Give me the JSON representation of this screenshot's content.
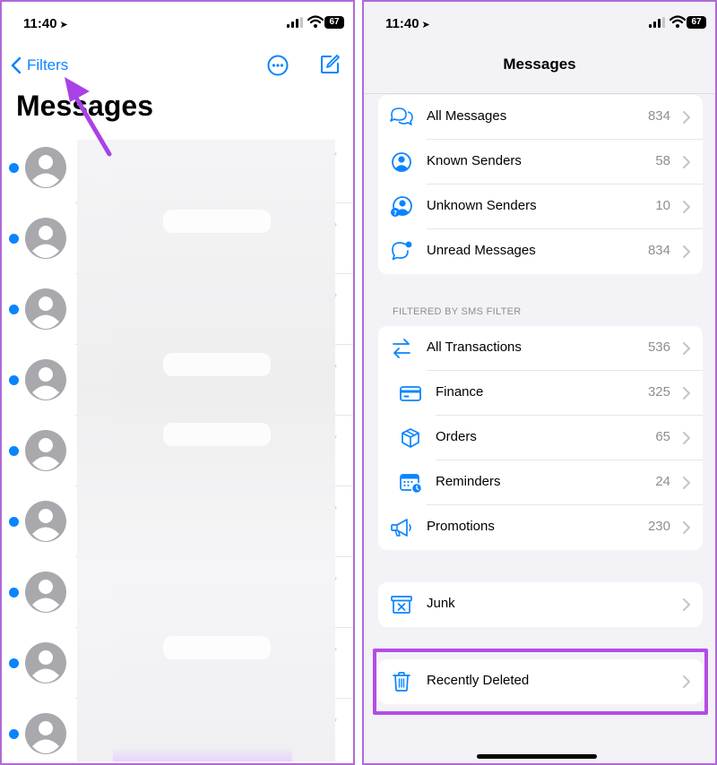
{
  "left": {
    "status": {
      "time": "11:40",
      "battery": "67"
    },
    "nav": {
      "back_label": "Filters"
    },
    "title": "Messages",
    "conversations": [
      {
        "unread": true
      },
      {
        "unread": true
      },
      {
        "unread": true
      },
      {
        "unread": true
      },
      {
        "unread": true
      },
      {
        "unread": true
      },
      {
        "unread": true
      },
      {
        "unread": true
      },
      {
        "unread": true
      }
    ]
  },
  "right": {
    "status": {
      "time": "11:40",
      "battery": "67"
    },
    "title": "Messages",
    "main_filters": [
      {
        "label": "All Messages",
        "count": "834",
        "icon": "all-messages-icon"
      },
      {
        "label": "Known Senders",
        "count": "58",
        "icon": "known-senders-icon"
      },
      {
        "label": "Unknown Senders",
        "count": "10",
        "icon": "unknown-senders-icon"
      },
      {
        "label": "Unread Messages",
        "count": "834",
        "icon": "unread-messages-icon"
      }
    ],
    "sms_filter_header": "FILTERED BY SMS FILTER",
    "sms_filters": [
      {
        "label": "All Transactions",
        "count": "536",
        "icon": "transactions-icon"
      },
      {
        "label": "Finance",
        "count": "325",
        "icon": "finance-icon"
      },
      {
        "label": "Orders",
        "count": "65",
        "icon": "orders-icon"
      },
      {
        "label": "Reminders",
        "count": "24",
        "icon": "reminders-icon"
      },
      {
        "label": "Promotions",
        "count": "230",
        "icon": "promotions-icon"
      }
    ],
    "junk": {
      "label": "Junk",
      "icon": "junk-icon"
    },
    "recently_deleted": {
      "label": "Recently Deleted",
      "icon": "trash-icon"
    }
  },
  "colors": {
    "accent": "#0a84ff",
    "highlight": "#b54ce6",
    "background": "#f2f2f7"
  }
}
